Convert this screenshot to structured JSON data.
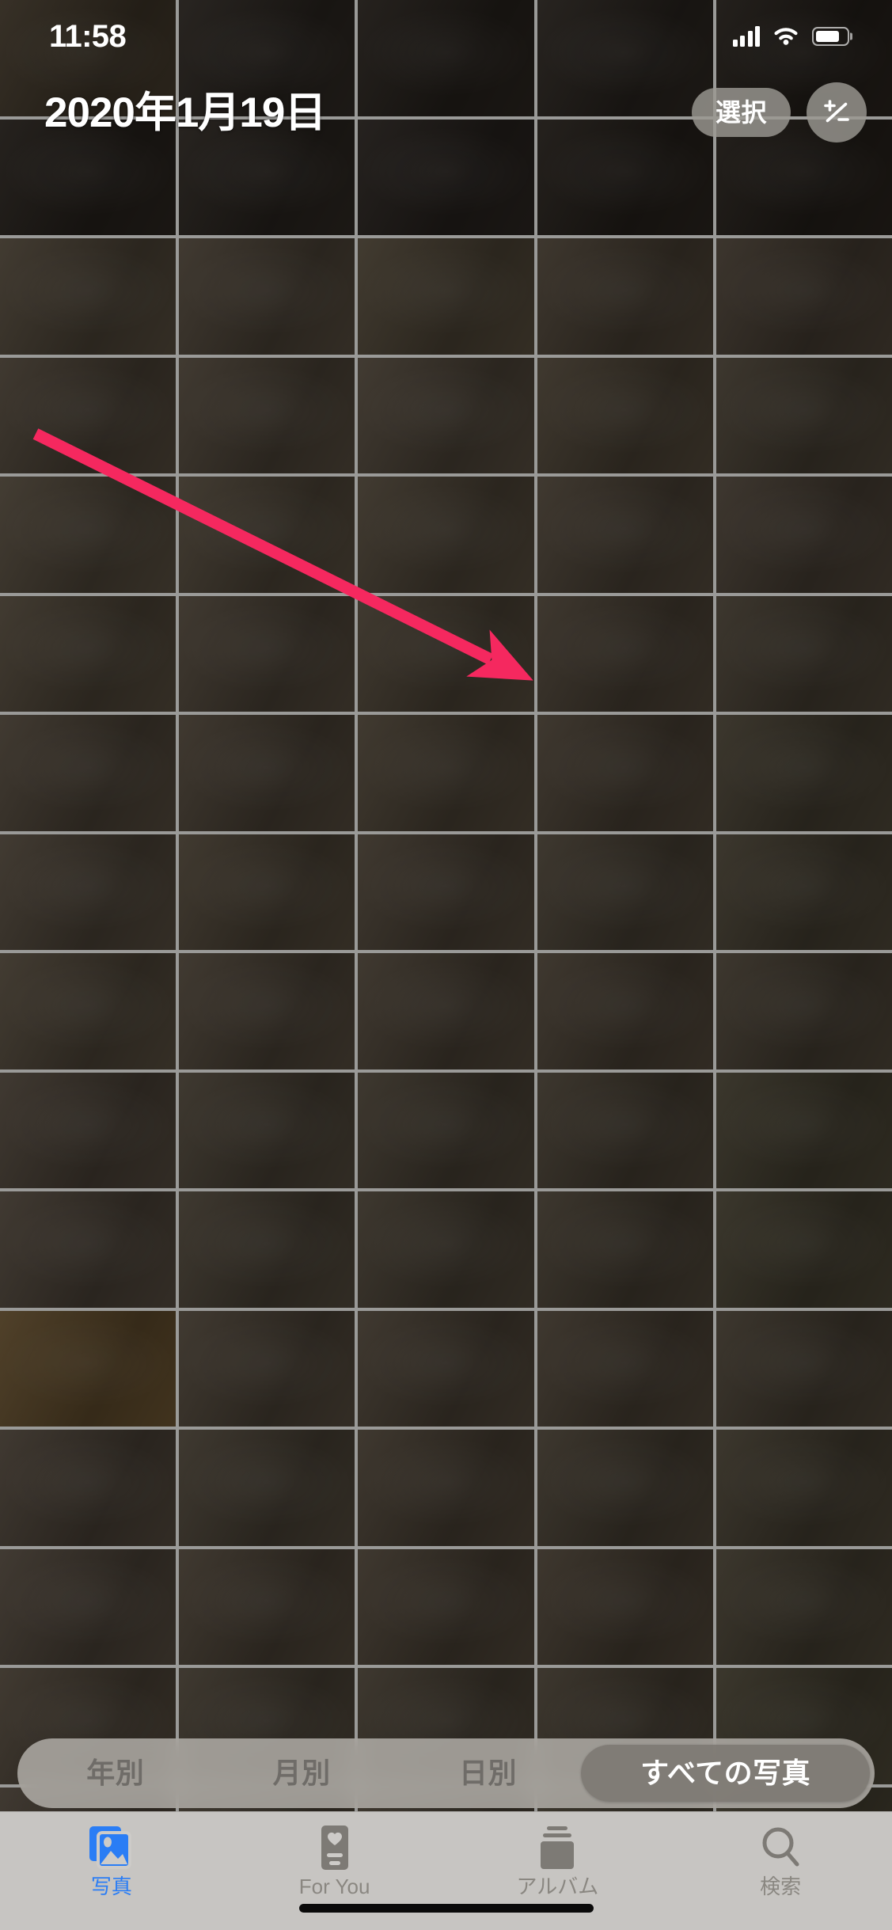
{
  "status_bar": {
    "time": "11:58",
    "cellular_icon": "cellular-bars-icon",
    "wifi_icon": "wifi-icon",
    "battery_icon": "battery-icon"
  },
  "nav": {
    "title": "2020年1月19日",
    "select_label": "選択",
    "zoom_button_icon": "plus-minus-zoom-icon"
  },
  "grid": {
    "columns": 5,
    "rows": 16,
    "cells": [
      {
        "tone": "#30291f"
      },
      {
        "tone": "#211d19"
      },
      {
        "tone": "#1e1a16"
      },
      {
        "tone": "#201c18"
      },
      {
        "tone": "#1c1814"
      },
      {
        "tone": "#1e1a16"
      },
      {
        "tone": "#201c18"
      },
      {
        "tone": "#1e1a17"
      },
      {
        "tone": "#1d1915"
      },
      {
        "tone": "#1c1814"
      },
      {
        "tone": "#3b342a"
      },
      {
        "tone": "#3a332a"
      },
      {
        "tone": "#3b3429"
      },
      {
        "tone": "#373027"
      },
      {
        "tone": "#352e26"
      },
      {
        "tone": "#393229"
      },
      {
        "tone": "#3a332a"
      },
      {
        "tone": "#3b342b"
      },
      {
        "tone": "#393228"
      },
      {
        "tone": "#363027"
      },
      {
        "tone": "#3d362c"
      },
      {
        "tone": "#3c352b"
      },
      {
        "tone": "#3b342a"
      },
      {
        "tone": "#393229"
      },
      {
        "tone": "#373028"
      },
      {
        "tone": "#3b342a"
      },
      {
        "tone": "#3a332a"
      },
      {
        "tone": "#3a3329"
      },
      {
        "tone": "#383128"
      },
      {
        "tone": "#363027"
      },
      {
        "tone": "#3a332a"
      },
      {
        "tone": "#393229"
      },
      {
        "tone": "#3a3329"
      },
      {
        "tone": "#383128"
      },
      {
        "tone": "#353026"
      },
      {
        "tone": "#3b342b"
      },
      {
        "tone": "#3a3329"
      },
      {
        "tone": "#393229"
      },
      {
        "tone": "#373128"
      },
      {
        "tone": "#353026"
      },
      {
        "tone": "#3c352b"
      },
      {
        "tone": "#3a332a"
      },
      {
        "tone": "#393229"
      },
      {
        "tone": "#383128"
      },
      {
        "tone": "#363027"
      },
      {
        "tone": "#39322a"
      },
      {
        "tone": "#383229"
      },
      {
        "tone": "#373128"
      },
      {
        "tone": "#363027"
      },
      {
        "tone": "#343025"
      },
      {
        "tone": "#3a332b"
      },
      {
        "tone": "#383229"
      },
      {
        "tone": "#373128"
      },
      {
        "tone": "#363027"
      },
      {
        "tone": "#343025"
      },
      {
        "tone": "#4a3a22"
      },
      {
        "tone": "#3a332a"
      },
      {
        "tone": "#393229"
      },
      {
        "tone": "#383128"
      },
      {
        "tone": "#363027"
      },
      {
        "tone": "#39322a"
      },
      {
        "tone": "#383229"
      },
      {
        "tone": "#383128"
      },
      {
        "tone": "#363027"
      },
      {
        "tone": "#353026"
      },
      {
        "tone": "#3a332b"
      },
      {
        "tone": "#393229"
      },
      {
        "tone": "#383128"
      },
      {
        "tone": "#373027"
      },
      {
        "tone": "#353026"
      },
      {
        "tone": "#3a332a"
      },
      {
        "tone": "#383229"
      },
      {
        "tone": "#373128"
      },
      {
        "tone": "#363027"
      },
      {
        "tone": "#343025"
      },
      {
        "tone": "#39322a"
      },
      {
        "tone": "#383229"
      },
      {
        "tone": "#373128"
      },
      {
        "tone": "#353026"
      },
      {
        "tone": "#343025"
      }
    ]
  },
  "segmented_control": {
    "items": [
      {
        "label": "年別",
        "active": false
      },
      {
        "label": "月別",
        "active": false
      },
      {
        "label": "日別",
        "active": false
      },
      {
        "label": "すべての写真",
        "active": true
      }
    ]
  },
  "tab_bar": {
    "items": [
      {
        "label": "写真",
        "icon": "photos-icon",
        "active": true
      },
      {
        "label": "For You",
        "icon": "for-you-icon",
        "active": false
      },
      {
        "label": "アルバム",
        "icon": "albums-icon",
        "active": false
      },
      {
        "label": "検索",
        "icon": "search-icon",
        "active": false
      }
    ]
  },
  "annotation": {
    "arrow_color": "#f5285f",
    "arrow_start": "45,548",
    "arrow_end": "672,858"
  },
  "colors": {
    "accent_blue": "#2a7df5",
    "annotation_pink": "#f5285f",
    "grid_line": "#9a9a98",
    "tabbar_bg": "#cdcbc8"
  }
}
